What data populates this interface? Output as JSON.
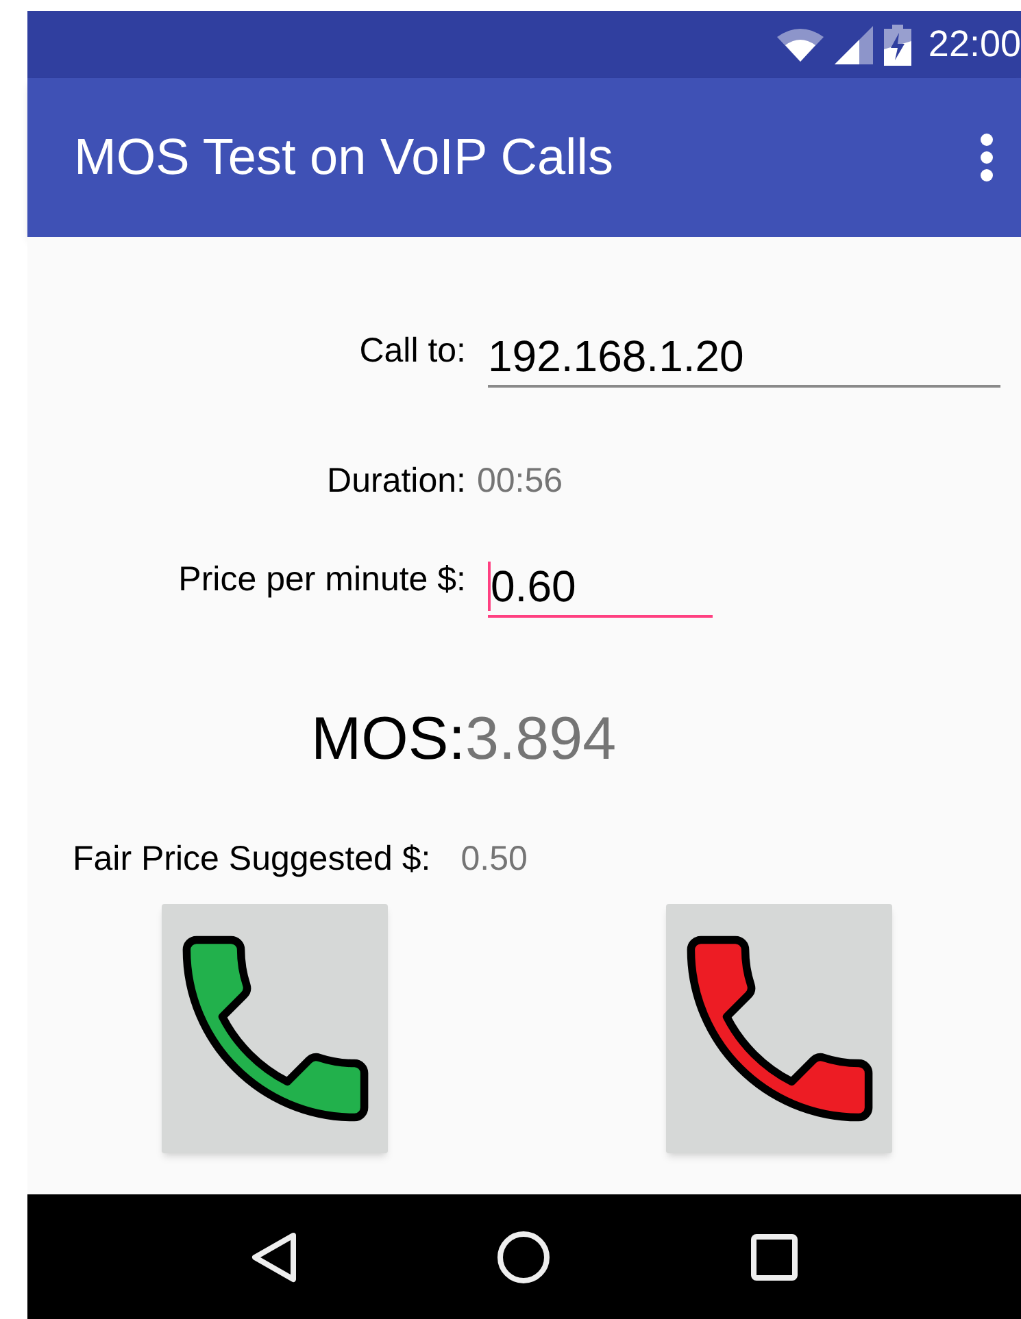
{
  "status_bar": {
    "time": "22:00"
  },
  "app_bar": {
    "title": "MOS Test on VoIP Calls"
  },
  "call_to": {
    "label": "Call to:",
    "value": "192.168.1.20",
    "focused": false
  },
  "duration": {
    "label": "Duration:",
    "value": "00:56"
  },
  "price": {
    "label": "Price per minute $:",
    "value": "0.60",
    "focused": true
  },
  "mos": {
    "label": "MOS:",
    "value": "3.894"
  },
  "fair_price": {
    "label": "Fair Price Suggested $:",
    "value": "0.50"
  },
  "call_buttons": [
    {
      "color": "#22b14c"
    },
    {
      "color": "#ed1c24"
    }
  ]
}
